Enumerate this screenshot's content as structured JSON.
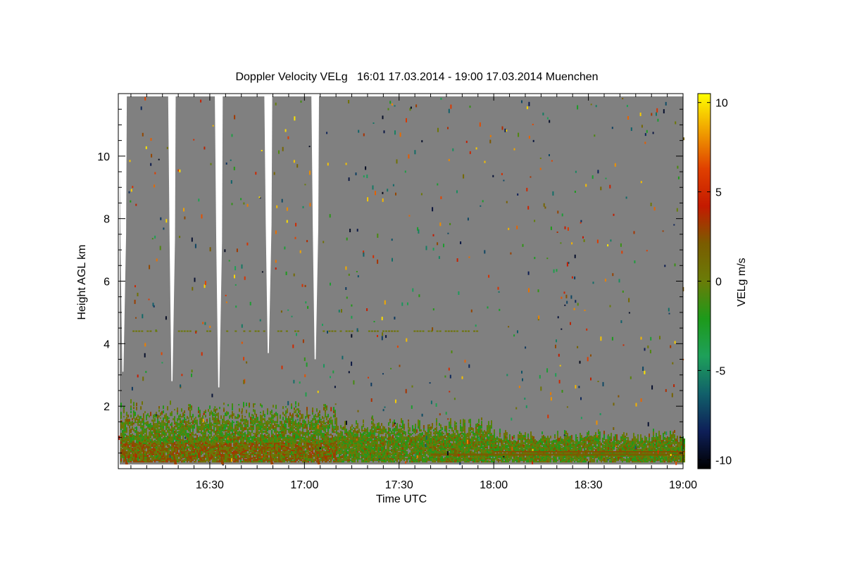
{
  "chart_data": {
    "type": "heatmap",
    "title": "Doppler Velocity VELg   16:01 17.03.2014 - 19:00 17.03.2014 Muenchen",
    "xlabel": "Time UTC",
    "ylabel": "Height AGL km",
    "x_ticks": [
      "16:30",
      "17:00",
      "17:30",
      "18:00",
      "18:30",
      "19:00"
    ],
    "x_tick_minutes": [
      30,
      60,
      90,
      120,
      150,
      180
    ],
    "x_range_minutes": [
      1,
      180
    ],
    "y_ticks": [
      2,
      4,
      6,
      8,
      10
    ],
    "ylim": [
      0,
      12
    ],
    "colorbar": {
      "label": "VELg m/s",
      "ticks": [
        -10,
        -5,
        0,
        5,
        10
      ],
      "range": [
        -10.5,
        10.5
      ],
      "colors": [
        "#000000",
        "#0e1f58",
        "#11606a",
        "#1ea05a",
        "#1d9a1a",
        "#6a7c08",
        "#7a5c00",
        "#c41a00",
        "#e04000",
        "#f0a000",
        "#ffff00"
      ]
    },
    "background_color": "#808080",
    "no_data_gaps": [
      {
        "start_minute": 1.2,
        "end_minute": 3.7,
        "top_km": 12,
        "bottom_km": 3.1
      },
      {
        "start_minute": 16.8,
        "end_minute": 19.2,
        "top_km": 12,
        "bottom_km": 2.8
      },
      {
        "start_minute": 31.6,
        "end_minute": 34.1,
        "top_km": 12,
        "bottom_km": 2.6
      },
      {
        "start_minute": 47.3,
        "end_minute": 49.8,
        "top_km": 12,
        "bottom_km": 3.7
      },
      {
        "start_minute": 62.2,
        "end_minute": 64.6,
        "top_km": 12,
        "bottom_km": 3.5
      }
    ],
    "features": [
      {
        "name": "boundary layer echo",
        "from_minute": 1,
        "to_minute": 180,
        "height_km": [
          0.2,
          1.9
        ],
        "velocity_ms": [
          -3,
          3
        ]
      },
      {
        "name": "echo layer at 4.4 km",
        "from_minute": 1,
        "to_minute": 117,
        "height_km": 4.4,
        "velocity_ms": 0.5
      },
      {
        "name": "persistent layer near ground",
        "from_minute": 100,
        "to_minute": 180,
        "height_km": 0.45,
        "velocity_ms": 2
      }
    ]
  }
}
